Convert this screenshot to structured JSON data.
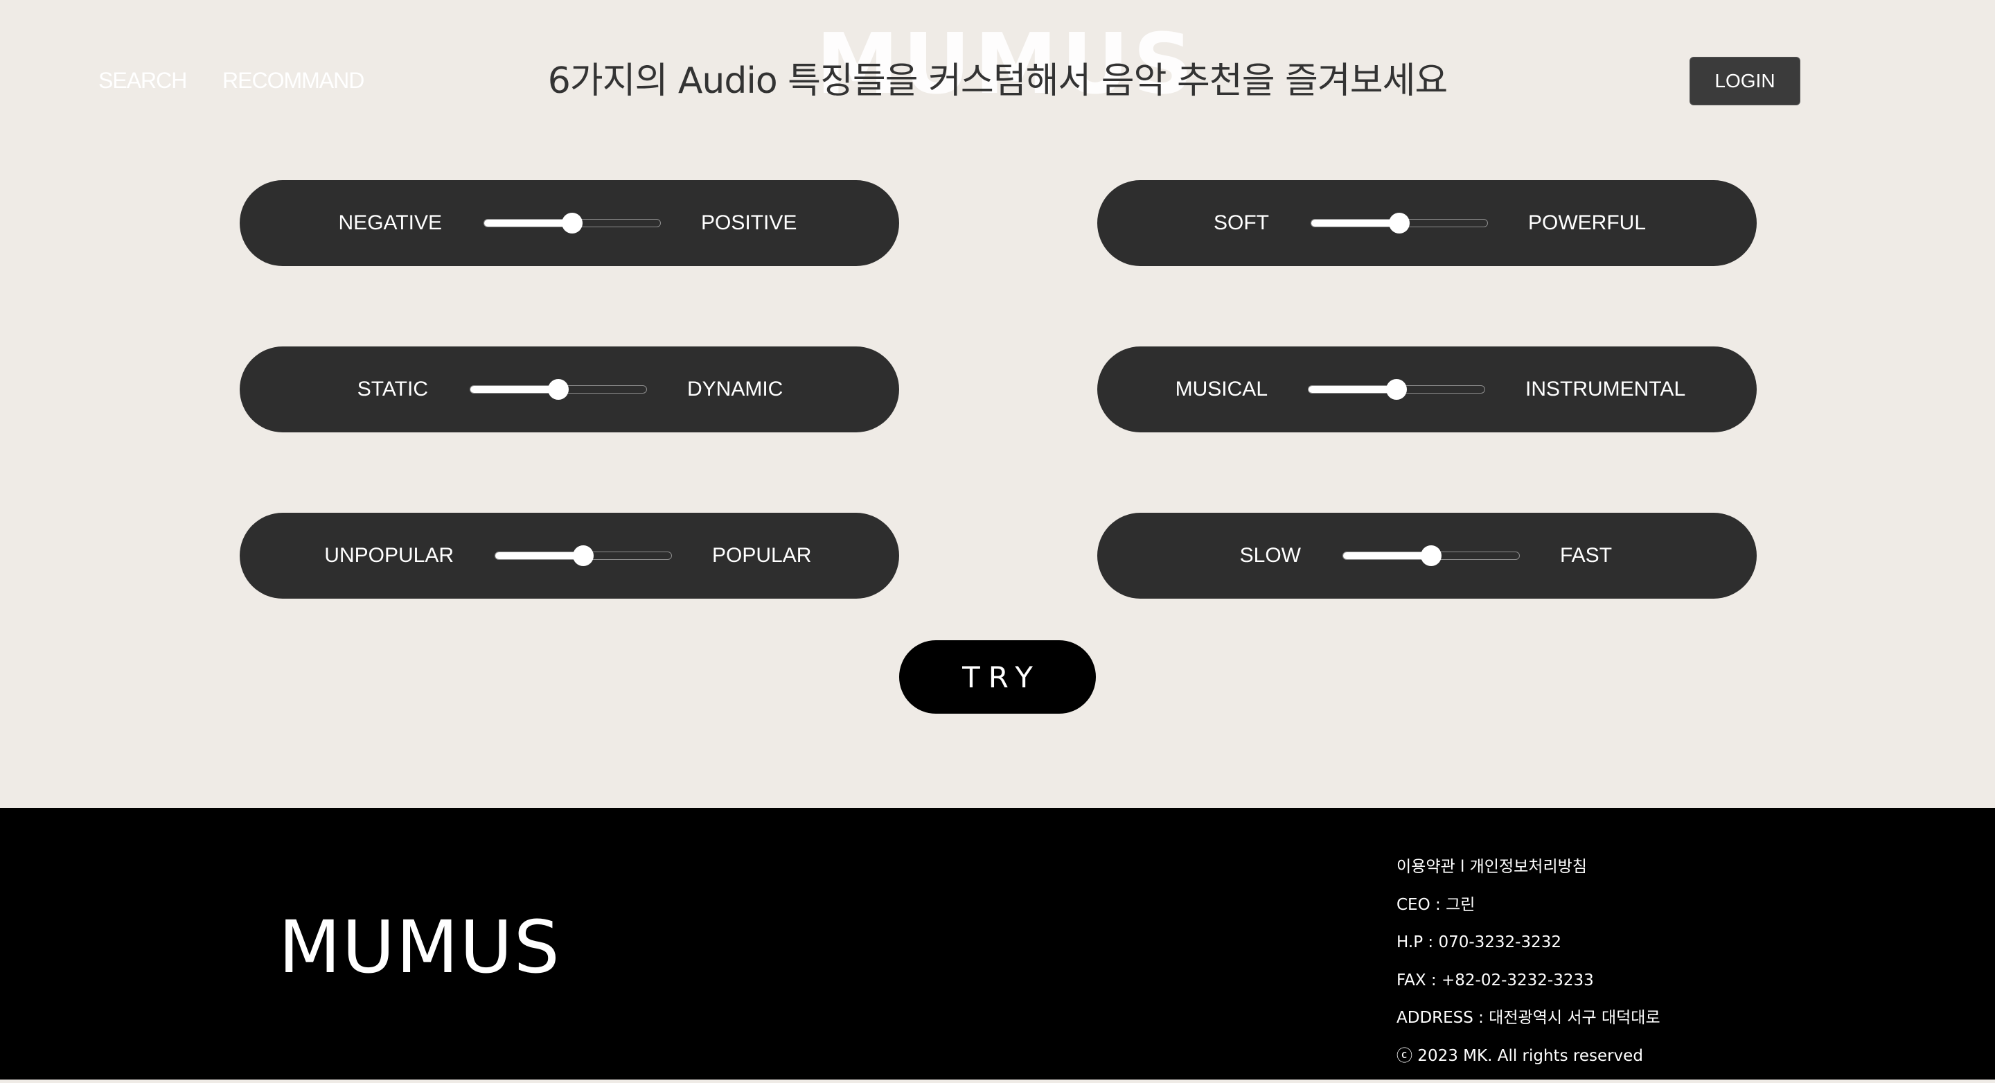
{
  "header": {
    "nav": [
      "SEARCH",
      "RECOMMAND"
    ],
    "watermark": "MUMUS",
    "title": "6가지의 Audio 특징들을 커스텀해서 음악 추천을 즐겨보세요",
    "login_label": "LOGIN"
  },
  "sliders": [
    {
      "left_label": "NEGATIVE",
      "right_label": "POSITIVE",
      "value": 0.5
    },
    {
      "left_label": "SOFT",
      "right_label": "POWERFUL",
      "value": 0.5
    },
    {
      "left_label": "STATIC",
      "right_label": "DYNAMIC",
      "value": 0.5
    },
    {
      "left_label": "MUSICAL",
      "right_label": "INSTRUMENTAL",
      "value": 0.5
    },
    {
      "left_label": "UNPOPULAR",
      "right_label": "POPULAR",
      "value": 0.5
    },
    {
      "left_label": "SLOW",
      "right_label": "FAST",
      "value": 0.5
    }
  ],
  "try_label": "TRY",
  "footer": {
    "brand": "MUMUS",
    "lines": [
      "이용약관 l 개인정보처리방침",
      "CEO : 그린",
      "H.P : 070-3232-3232",
      "FAX : +82-02-3232-3233",
      "ADDRESS : 대전광역시 서구 대덕대로",
      "ⓒ 2023 MK. All rights reserved"
    ]
  },
  "colors": {
    "background": "#efebe6",
    "pill": "#2e2e2e",
    "footer": "#000000",
    "accent": "#ffffff"
  }
}
